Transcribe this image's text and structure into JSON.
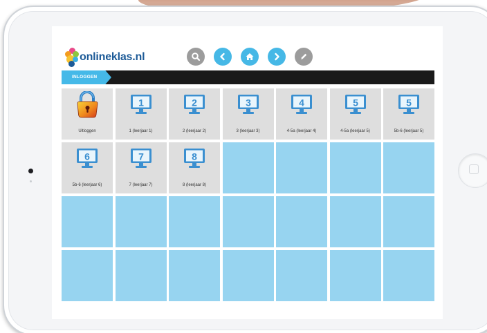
{
  "app": {
    "logo_text": "onlineklas.nl"
  },
  "nav": {
    "icons": [
      "search-icon",
      "chevron-left-icon",
      "home-icon",
      "chevron-right-icon",
      "pencil-icon"
    ]
  },
  "header_bar": {
    "tab_label": "INLOGGEN"
  },
  "tiles": [
    {
      "label": "Uitloggen",
      "icon": "lock-icon"
    },
    {
      "label": "1 (leerjaar 1)",
      "number": "1",
      "icon": "monitor-icon"
    },
    {
      "label": "2 (leerjaar 2)",
      "number": "2",
      "icon": "monitor-icon"
    },
    {
      "label": "3 (leerjaar 3)",
      "number": "3",
      "icon": "monitor-icon"
    },
    {
      "label": "4-5a (leerjaar 4)",
      "number": "4",
      "icon": "monitor-icon"
    },
    {
      "label": "4-5a (leerjaar 5)",
      "number": "5",
      "icon": "monitor-icon"
    },
    {
      "label": "5b-6 (leerjaar 5)",
      "number": "5",
      "icon": "monitor-icon"
    },
    {
      "label": "5b-6 (leerjaar 6)",
      "number": "6",
      "icon": "monitor-icon"
    },
    {
      "label": "7 (leerjaar 7)",
      "number": "7",
      "icon": "monitor-icon"
    },
    {
      "label": "8 (leerjaar 8)",
      "number": "8",
      "icon": "monitor-icon"
    }
  ],
  "colors": {
    "accent_blue": "#45b9e8",
    "monitor_blue": "#3a8fd0",
    "empty_tile": "#97d4f0",
    "tile_grey": "#dedede",
    "header_dark": "#1a1a1a",
    "logo_blue": "#1c5a97"
  }
}
